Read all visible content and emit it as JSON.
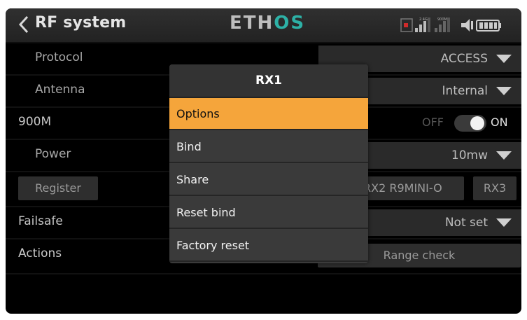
{
  "header": {
    "title": "RF system",
    "logo_left": "ETH",
    "logo_right": "OS",
    "status_labels": [
      "2.4G",
      "900M"
    ]
  },
  "rows": {
    "protocol": {
      "label": "Protocol",
      "value": "ACCESS"
    },
    "antenna": {
      "label": "Antenna",
      "value": "Internal"
    },
    "m900": {
      "label": "900M",
      "off": "OFF",
      "on": "ON"
    },
    "power": {
      "label": "Power",
      "value": "10mw"
    },
    "register": {
      "button": "Register",
      "rx2": "RX2 R9MINI-O",
      "rx3": "RX3"
    },
    "failsafe": {
      "label": "Failsafe",
      "value": "Not set"
    },
    "actions": {
      "label": "Actions",
      "button": "Range check"
    }
  },
  "dialog": {
    "title": "RX1",
    "options": [
      "Options",
      "Bind",
      "Share",
      "Reset bind",
      "Factory reset"
    ],
    "selected_index": 0
  },
  "colors": {
    "accent": "#f5a53b",
    "logo_accent": "#2db1a6"
  }
}
